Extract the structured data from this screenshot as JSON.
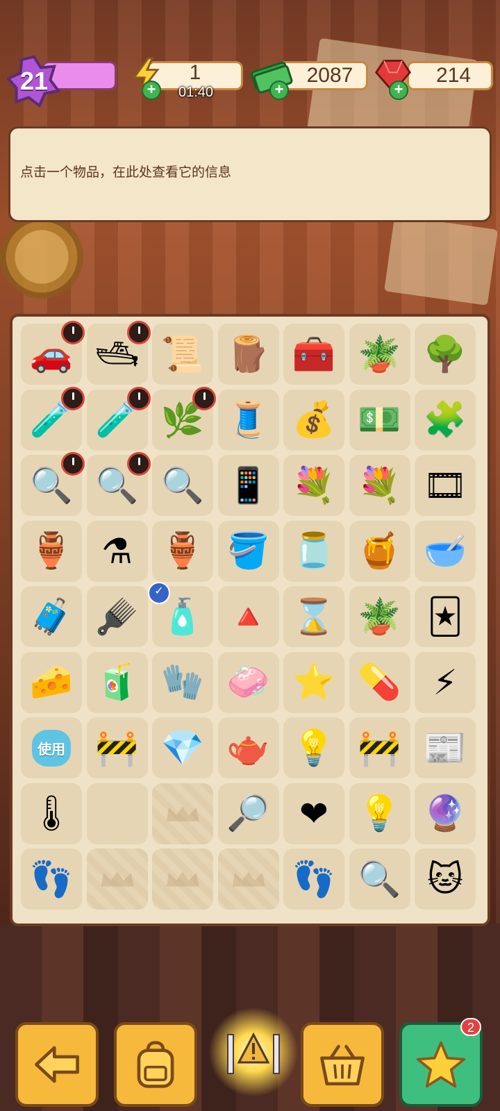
{
  "top_bar": {
    "level": "21",
    "energy": "1",
    "energy_timer": "01:40",
    "cash": "2087",
    "gems": "214"
  },
  "info_panel": {
    "text": "点击一个物品，在此处查看它的信息"
  },
  "board": {
    "use_label": "使用",
    "rows": [
      [
        "purple-car",
        "jet-ski",
        "paper-scroll-item",
        "wooden-planks",
        "toolbox-red",
        "potted-plant",
        "flowering-tree"
      ],
      [
        "medicine-kit",
        "medicine-kit",
        "herb-pot",
        "sewing-machine",
        "money-sack",
        "cash-bundle",
        "jigsaw-box"
      ],
      [
        "crime-scene-board",
        "crime-scene-board",
        "crime-scene-board",
        "tablet-device",
        "flower-bed",
        "flower-bed",
        "film-reel"
      ],
      [
        "clay-pot",
        "potion-vase",
        "ceramic-vase",
        "clay-pot-small",
        "jam-jar",
        "honey-dipper",
        "cat-bowl"
      ],
      [
        "first-aid-case",
        "hair-brush",
        "spray-bottle",
        "cone-stand",
        "hourglass-tile",
        "flower-pot",
        "playing-card"
      ],
      [
        "cheese-wheel",
        "juice-bottle",
        "red-gloves",
        "soap-bar",
        "purple-star",
        "bandage-bottle",
        "energy-orb"
      ],
      [
        "use-bubble",
        "barrier",
        "purple-gem",
        "blue-teapot",
        "street-lamp",
        "barrier",
        "wanted-poster"
      ],
      [
        "thermometer-gun",
        "empty",
        "locked-slot",
        "magnifier",
        "hearts",
        "light-bulb",
        "lamp-box"
      ],
      [
        "evidence-bag",
        "locked-slot",
        "locked-slot",
        "locked-slot",
        "evidence-bag",
        "magnifier-blue",
        "lucky-cat"
      ]
    ],
    "timer_badges": [
      [
        0,
        0
      ],
      [
        0,
        1
      ],
      [
        1,
        0
      ],
      [
        1,
        1
      ],
      [
        1,
        2
      ],
      [
        2,
        0
      ],
      [
        2,
        1
      ]
    ],
    "check_badges": [
      [
        4,
        2
      ]
    ]
  },
  "bottom_bar": {
    "star_badge": "2"
  },
  "colors": {
    "accent_button": "#f6b93b",
    "star_button": "#3fbf7f",
    "board_bg": "#efe2c6"
  }
}
